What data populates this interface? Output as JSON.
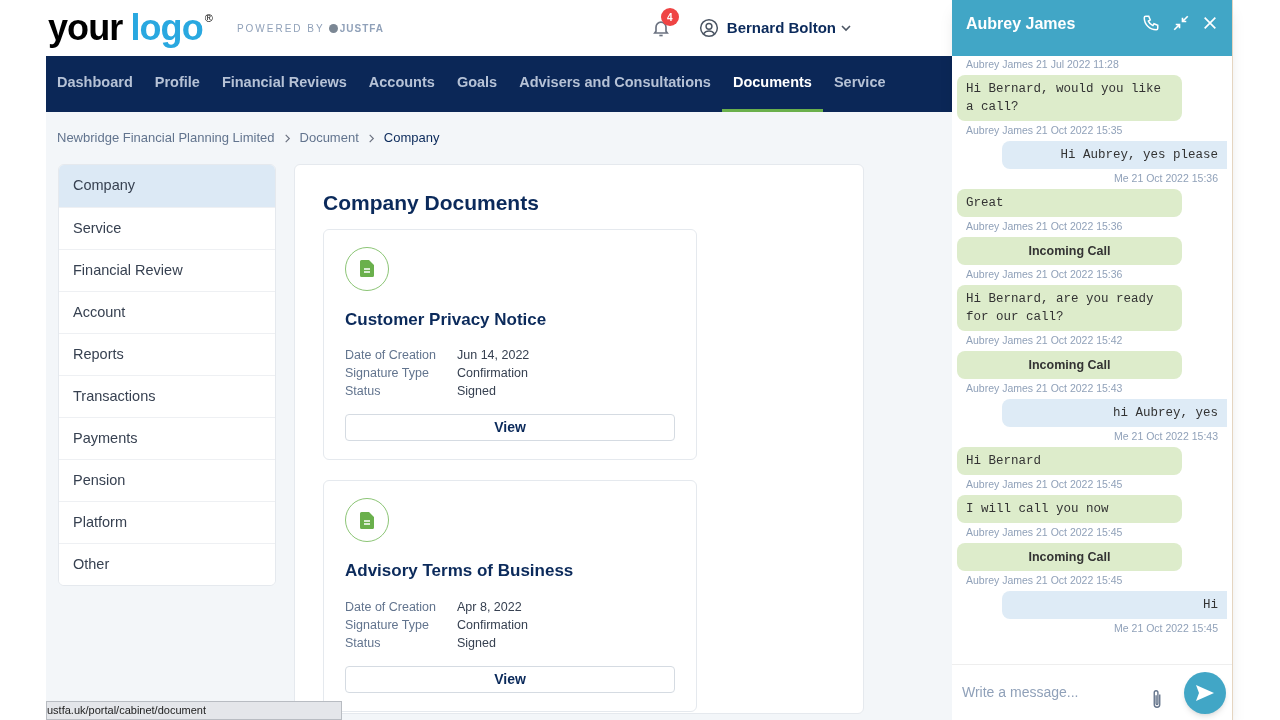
{
  "header": {
    "logo_word_1": "your",
    "logo_word_2": "logo",
    "logo_mark": "®",
    "powered_by": "POWERED BY",
    "powered_brand": "JUSTFA",
    "notification_count": "4",
    "user_name": "Bernard Bolton"
  },
  "nav": [
    {
      "label": "Dashboard",
      "selected": false
    },
    {
      "label": "Profile",
      "selected": false
    },
    {
      "label": "Financial Reviews",
      "selected": false
    },
    {
      "label": "Accounts",
      "selected": false
    },
    {
      "label": "Goals",
      "selected": false
    },
    {
      "label": "Advisers and Consultations",
      "selected": false
    },
    {
      "label": "Documents",
      "selected": true
    },
    {
      "label": "Service",
      "selected": false
    }
  ],
  "breadcrumb": [
    "Newbridge Financial Planning Limited",
    "Document",
    "Company"
  ],
  "sidebar": {
    "items": [
      {
        "label": "Company",
        "selected": true
      },
      {
        "label": "Service",
        "selected": false
      },
      {
        "label": "Financial Review",
        "selected": false
      },
      {
        "label": "Account",
        "selected": false
      },
      {
        "label": "Reports",
        "selected": false
      },
      {
        "label": "Transactions",
        "selected": false
      },
      {
        "label": "Payments",
        "selected": false
      },
      {
        "label": "Pension",
        "selected": false
      },
      {
        "label": "Platform",
        "selected": false
      },
      {
        "label": "Other",
        "selected": false
      }
    ]
  },
  "content": {
    "title": "Company Documents",
    "documents": [
      {
        "title": "Customer Privacy Notice",
        "fields": [
          {
            "label": "Date of Creation",
            "value": "Jun 14, 2022"
          },
          {
            "label": "Signature Type",
            "value": "Confirmation"
          },
          {
            "label": "Status",
            "value": "Signed"
          }
        ],
        "button": "View"
      },
      {
        "title": "Advisory Terms of Business",
        "fields": [
          {
            "label": "Date of Creation",
            "value": "Apr 8, 2022"
          },
          {
            "label": "Signature Type",
            "value": "Confirmation"
          },
          {
            "label": "Status",
            "value": "Signed"
          }
        ],
        "button": "View"
      }
    ]
  },
  "status_url": "ustfa.uk/portal/cabinet/document",
  "chat": {
    "title": "Aubrey James",
    "first_meta": "Aubrey James 21 Jul 2022 11:28",
    "messages": [
      {
        "kind": "received",
        "text": "Hi Bernard, would you like a call?",
        "meta": "Aubrey James 21 Oct 2022 15:35"
      },
      {
        "kind": "sent",
        "text": "Hi Aubrey, yes please",
        "meta": "Me 21 Oct 2022 15:36"
      },
      {
        "kind": "received",
        "text": "Great",
        "meta": "Aubrey James 21 Oct 2022 15:36"
      },
      {
        "kind": "call",
        "text": "Incoming Call",
        "meta": "Aubrey James 21 Oct 2022 15:36"
      },
      {
        "kind": "received",
        "text": "Hi Bernard, are you ready for our call?",
        "meta": "Aubrey James 21 Oct 2022 15:42"
      },
      {
        "kind": "call",
        "text": "Incoming Call",
        "meta": "Aubrey James 21 Oct 2022 15:43"
      },
      {
        "kind": "sent",
        "text": "hi Aubrey, yes",
        "meta": "Me 21 Oct 2022 15:43"
      },
      {
        "kind": "received",
        "text": "Hi Bernard",
        "meta": "Aubrey James 21 Oct 2022 15:45"
      },
      {
        "kind": "received",
        "text": "I will call you now",
        "meta": "Aubrey James 21 Oct 2022 15:45"
      },
      {
        "kind": "call",
        "text": "Incoming Call",
        "meta": "Aubrey James 21 Oct 2022 15:45"
      },
      {
        "kind": "sent",
        "text": "Hi",
        "meta": "Me 21 Oct 2022 15:45"
      }
    ],
    "input": {
      "placeholder": "Write a message..."
    }
  }
}
